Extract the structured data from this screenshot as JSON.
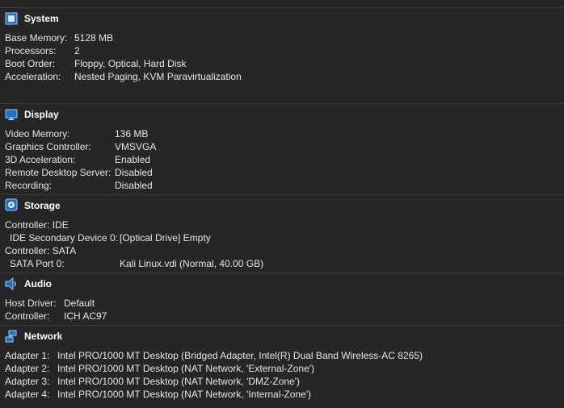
{
  "system": {
    "title": "System",
    "icon": "system-chip-icon",
    "rows": [
      {
        "label": "Base Memory:",
        "value": "5128 MB"
      },
      {
        "label": "Processors:",
        "value": "2"
      },
      {
        "label": "Boot Order:",
        "value": "Floppy, Optical, Hard Disk"
      },
      {
        "label": "Acceleration:",
        "value": "Nested Paging, KVM Paravirtualization"
      }
    ]
  },
  "display": {
    "title": "Display",
    "icon": "monitor-icon",
    "rows": [
      {
        "label": "Video Memory:",
        "value": "136 MB"
      },
      {
        "label": "Graphics Controller:",
        "value": "VMSVGA"
      },
      {
        "label": "3D Acceleration:",
        "value": "Enabled"
      },
      {
        "label": "Remote Desktop Server:",
        "value": "Disabled"
      },
      {
        "label": "Recording:",
        "value": "Disabled"
      }
    ]
  },
  "storage": {
    "title": "Storage",
    "icon": "hard-disk-icon",
    "rows": [
      {
        "label": "Controller: IDE",
        "value": ""
      },
      {
        "label": "IDE Secondary Device 0:",
        "value": "[Optical Drive] Empty"
      },
      {
        "label": "Controller: SATA",
        "value": ""
      },
      {
        "label": "SATA Port 0:",
        "value": "Kali Linux.vdi (Normal, 40.00 GB)"
      }
    ]
  },
  "audio": {
    "title": "Audio",
    "icon": "speaker-icon",
    "rows": [
      {
        "label": "Host Driver:",
        "value": "Default"
      },
      {
        "label": "Controller:",
        "value": "ICH AC97"
      }
    ]
  },
  "network": {
    "title": "Network",
    "icon": "network-icon",
    "rows": [
      {
        "label": "Adapter 1:",
        "value": "Intel PRO/1000 MT Desktop (Bridged Adapter, Intel(R) Dual Band Wireless-AC 8265)"
      },
      {
        "label": "Adapter 2:",
        "value": "Intel PRO/1000 MT Desktop (NAT Network, 'External-Zone')"
      },
      {
        "label": "Adapter 3:",
        "value": "Intel PRO/1000 MT Desktop (NAT Network, 'DMZ-Zone')"
      },
      {
        "label": "Adapter 4:",
        "value": "Intel PRO/1000 MT Desktop (NAT Network, 'Internal-Zone')"
      }
    ]
  }
}
